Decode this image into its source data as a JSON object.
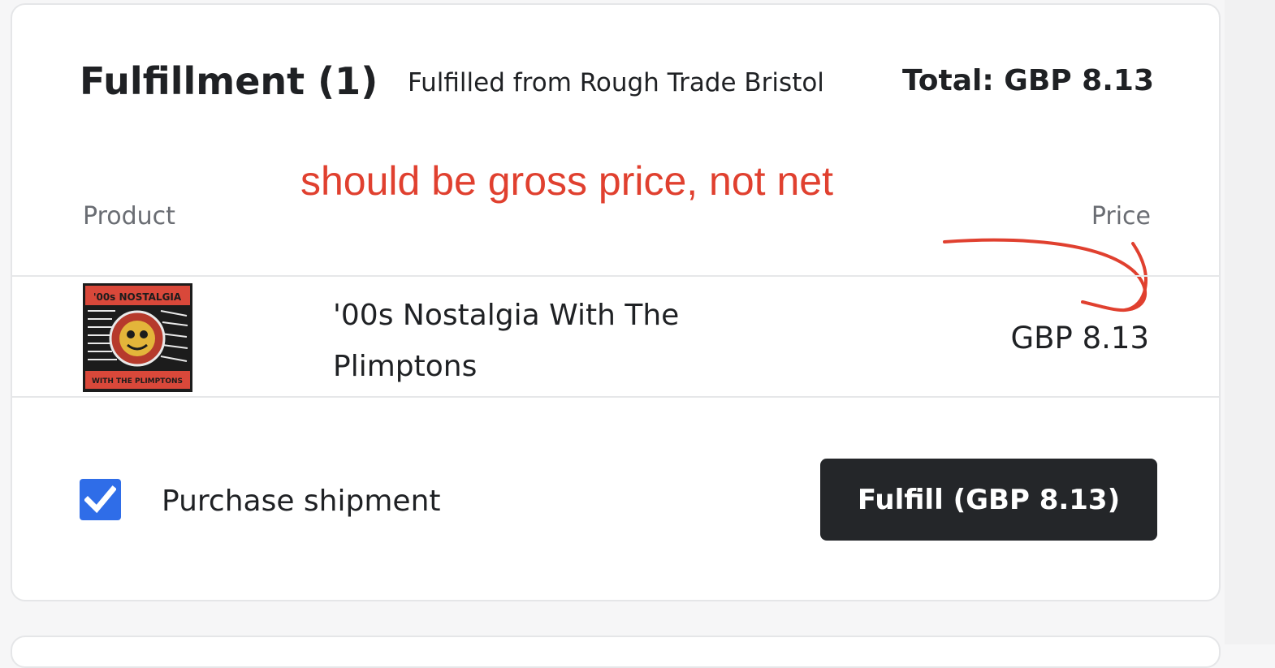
{
  "fulfillment": {
    "title": "Fulfillment (1)",
    "location": "Fulfilled from Rough Trade Bristol",
    "total": "Total: GBP 8.13"
  },
  "table": {
    "columns": {
      "product": "Product",
      "price": "Price"
    },
    "rows": [
      {
        "name": "'00s Nostalgia With The Plimptons",
        "price": "GBP 8.13",
        "thumbnail_text_top": "'00s NOSTALGIA",
        "thumbnail_text_bottom": "WITH THE PLIMPTONS"
      }
    ]
  },
  "annotation": {
    "text": "should be gross price, not net",
    "color": "#e0402f"
  },
  "shipment": {
    "checked": true,
    "label": "Purchase shipment"
  },
  "actions": {
    "fulfill_label": "Fulfill (GBP 8.13)"
  },
  "colors": {
    "checkbox": "#2f6de8",
    "button": "#242629"
  }
}
